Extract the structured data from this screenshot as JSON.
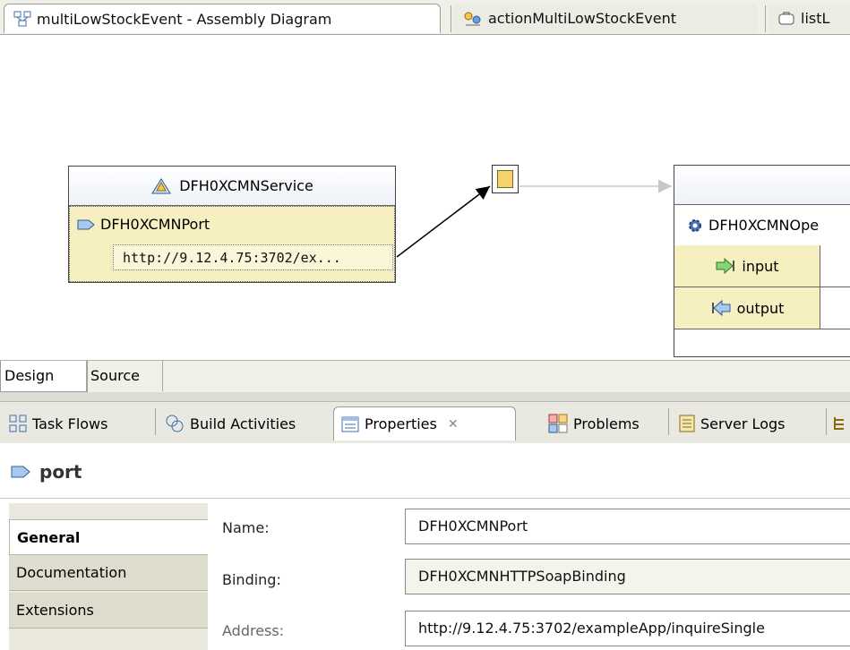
{
  "editor_tabs": [
    {
      "label": "multiLowStockEvent - Assembly Diagram",
      "icon": "assembly-diagram-icon"
    },
    {
      "label": "actionMultiLowStockEvent",
      "icon": "process-icon"
    },
    {
      "label": "listL",
      "icon": "interface-icon"
    }
  ],
  "diagram": {
    "service": {
      "name": "DFH0XCMNService",
      "port": "DFH0XCMNPort",
      "address": "http://9.12.4.75:3702/ex..."
    },
    "operation": {
      "name": "DFH0XCMNOpe",
      "input_label": "input",
      "output_label": "output"
    }
  },
  "editor_mode_tabs": [
    {
      "label": "Design"
    },
    {
      "label": "Source"
    }
  ],
  "view_tabs": [
    {
      "label": "Task Flows",
      "icon": "task-flows-icon"
    },
    {
      "label": "Build Activities",
      "icon": "build-activities-icon"
    },
    {
      "label": "Properties",
      "icon": "properties-icon"
    },
    {
      "label": "Problems",
      "icon": "problems-icon"
    },
    {
      "label": "Server Logs",
      "icon": "server-logs-icon"
    }
  ],
  "properties": {
    "title": "port",
    "sections": [
      "General",
      "Documentation",
      "Extensions"
    ],
    "selected_section": "General",
    "fields": {
      "name": {
        "label": "Name:",
        "value": "DFH0XCMNPort"
      },
      "binding": {
        "label": "Binding:",
        "value": "DFH0XCMNHTTPSoapBinding"
      },
      "address": {
        "label": "Address:",
        "value": "http://9.12.4.75:3702/exampleApp/inquireSingle"
      }
    }
  },
  "colors": {
    "node_fill": "#f6efbf",
    "chrome": "#f0efe8",
    "accent_blue": "#4a72b8"
  }
}
